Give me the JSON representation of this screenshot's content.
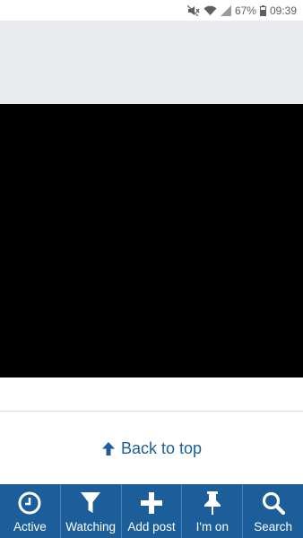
{
  "status_bar": {
    "battery_percent": "67%",
    "time": "09:39",
    "icons": [
      "mute-icon",
      "wifi-icon",
      "signal-icon",
      "battery-icon"
    ]
  },
  "page": {
    "back_to_top_label": "Back to top",
    "back_to_top_icon": "arrow-up-icon"
  },
  "bottom_nav": {
    "items": [
      {
        "label": "Active",
        "icon": "clock-icon"
      },
      {
        "label": "Watching",
        "icon": "filter-icon"
      },
      {
        "label": "Add post",
        "icon": "plus-icon"
      },
      {
        "label": "I'm on",
        "icon": "pin-icon"
      },
      {
        "label": "Search",
        "icon": "search-icon"
      }
    ]
  },
  "colors": {
    "accent": "#1c5e9a",
    "band": "#e9ebee",
    "video": "#000000"
  }
}
